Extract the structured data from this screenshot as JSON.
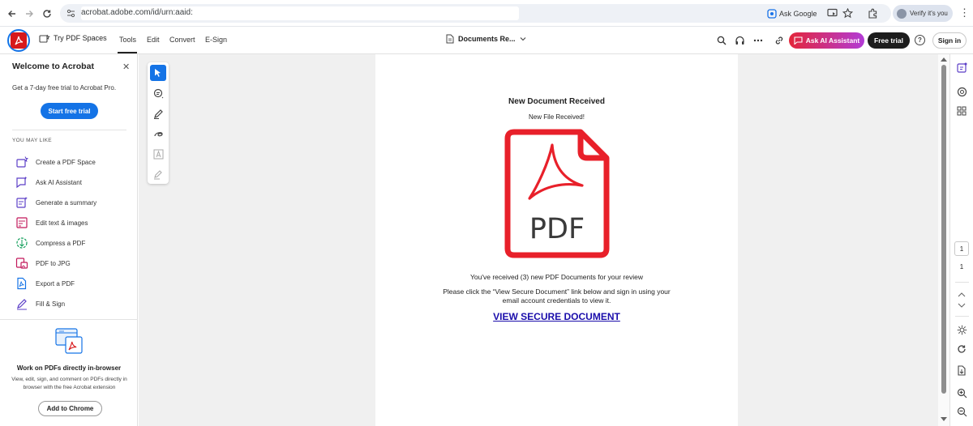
{
  "browser": {
    "url": "acrobat.adobe.com/id/urn:aaid:",
    "ask_google": "Ask Google",
    "verify": "Verify it's you"
  },
  "toolbar": {
    "try_spaces": "Try PDF Spaces",
    "tabs": [
      "Tools",
      "Edit",
      "Convert",
      "E-Sign"
    ],
    "document_name": "Documents Re...",
    "ask_ai": "Ask AI Assistant",
    "free_trial": "Free trial",
    "sign_in": "Sign in"
  },
  "left_panel": {
    "title": "Welcome to Acrobat",
    "subtitle": "Get a 7-day free trial to Acrobat Pro.",
    "cta": "Start free trial",
    "section_label": "YOU MAY LIKE",
    "items": [
      {
        "label": "Create a PDF Space",
        "icon": "pdf-space-icon"
      },
      {
        "label": "Ask AI Assistant",
        "icon": "ai-assistant-icon"
      },
      {
        "label": "Generate a summary",
        "icon": "summary-icon"
      },
      {
        "label": "Edit text & images",
        "icon": "edit-text-icon"
      },
      {
        "label": "Compress a PDF",
        "icon": "compress-icon"
      },
      {
        "label": "PDF to JPG",
        "icon": "pdf-to-jpg-icon"
      },
      {
        "label": "Export a PDF",
        "icon": "export-pdf-icon"
      },
      {
        "label": "Fill & Sign",
        "icon": "fill-sign-icon"
      }
    ],
    "promo_title": "Work on PDFs directly in-browser",
    "promo_desc": "View, edit, sign, and comment on PDFs directly in browser with the free Acrobat extension",
    "promo_button": "Add to Chrome"
  },
  "document": {
    "title": "New Document Received",
    "subtitle": "New File Received!",
    "icon_label": "PDF",
    "message1": "You've received (3) new PDF Documents for your review",
    "message2": "Please click the “View Secure Document” link below and sign in using your email account credentials to view it.",
    "link": "VIEW SECURE DOCUMENT"
  },
  "right_rail": {
    "current_page": "1",
    "total_pages": "1"
  },
  "colors": {
    "accent_blue": "#1473e6",
    "acrobat_red": "#d7191c",
    "pdf_icon_red": "#e8202a",
    "link": "#1a0dab"
  }
}
